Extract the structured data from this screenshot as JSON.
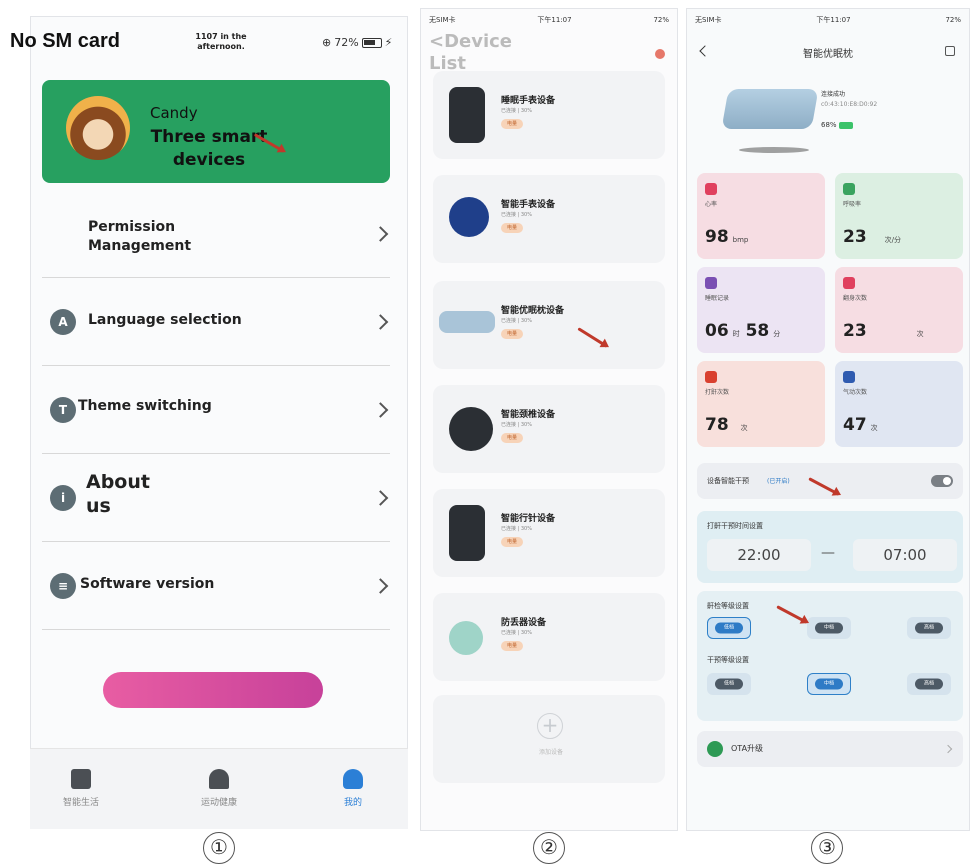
{
  "panel1": {
    "status": {
      "carrier": "No SM card",
      "time": "1107 in the afternoon.",
      "battery": "72%"
    },
    "profile": {
      "name": "Candy",
      "devices": "Three smart devices"
    },
    "menu": [
      {
        "label": "Permission Management",
        "icon": ""
      },
      {
        "label": "Language selection",
        "icon": "language-icon"
      },
      {
        "label": "Theme switching",
        "icon": "shirt-icon"
      },
      {
        "label": "About us",
        "icon": "info-icon"
      },
      {
        "label": "Software version",
        "icon": "layers-icon"
      }
    ],
    "tabs": [
      {
        "label": "智能生活",
        "icon": "home-icon"
      },
      {
        "label": "运动健康",
        "icon": "shoe-icon"
      },
      {
        "label": "我的",
        "icon": "person-icon"
      }
    ],
    "active_tab_color": "#2b7fd6",
    "caption": "①"
  },
  "panel2": {
    "status": {
      "carrier": "无SIM卡",
      "time": "下午11:07",
      "battery": "72%"
    },
    "title": "<Device List",
    "devices": [
      {
        "name": "睡眠手表设备",
        "sub": "已连接 | 30%",
        "tag": "电量"
      },
      {
        "name": "智能手表设备",
        "sub": "已连接 | 30%",
        "tag": "电量"
      },
      {
        "name": "智能优眠枕设备",
        "sub": "已连接 | 30%",
        "tag": "电量"
      },
      {
        "name": "智能颈椎设备",
        "sub": "已连接 | 30%",
        "tag": "电量"
      },
      {
        "name": "智能行针设备",
        "sub": "已连接 | 30%",
        "tag": "电量"
      },
      {
        "name": "防丢器设备",
        "sub": "已连接 | 30%",
        "tag": "电量"
      }
    ],
    "add_label": "添加设备",
    "caption": "②"
  },
  "panel3": {
    "status": {
      "carrier": "无SIM卡",
      "time": "下午11:07",
      "battery": "72%"
    },
    "title": "智能优眠枕",
    "device": {
      "status": "连接成功",
      "mac": "c0:43:10:E8:D0:92",
      "battery": "68%"
    },
    "metrics": [
      {
        "label": "心率",
        "value": "98",
        "unit": "bmp",
        "color": "#f6dde3",
        "icon_color": "#e0405e"
      },
      {
        "label": "呼吸率",
        "value": "23",
        "unit": "次/分",
        "color": "#dcefe2",
        "icon_color": "#3aa35f"
      },
      {
        "label": "睡眠记录",
        "value": "06",
        "unit": "时",
        "value2": "58",
        "unit2": "分",
        "color": "#ece4f3",
        "icon_color": "#7a4fb3"
      },
      {
        "label": "翻身次数",
        "value": "23",
        "unit": "次",
        "color": "#f6dde3",
        "icon_color": "#e0405e"
      },
      {
        "label": "打鼾次数",
        "value": "78",
        "unit": "次",
        "color": "#f8e0dc",
        "icon_color": "#d9402f"
      },
      {
        "label": "气动次数",
        "value": "47",
        "unit": "次",
        "color": "#e0e6f2",
        "icon_color": "#2f5bb0"
      }
    ],
    "intervention": {
      "label": "设备智能干预",
      "hint": "(已开启)",
      "enabled": false
    },
    "schedule": {
      "label": "打鼾干预时间设置",
      "start": "22:00",
      "sep": "—",
      "end": "07:00"
    },
    "snore_level": {
      "label": "鼾检等级设置",
      "options": [
        "低档",
        "中档",
        "高档"
      ],
      "selected": 0
    },
    "intervene_level": {
      "label": "干预等级设置",
      "options": [
        "低档",
        "中档",
        "高档"
      ],
      "selected": 1
    },
    "ota": {
      "label": "OTA升级"
    },
    "caption": "③"
  }
}
